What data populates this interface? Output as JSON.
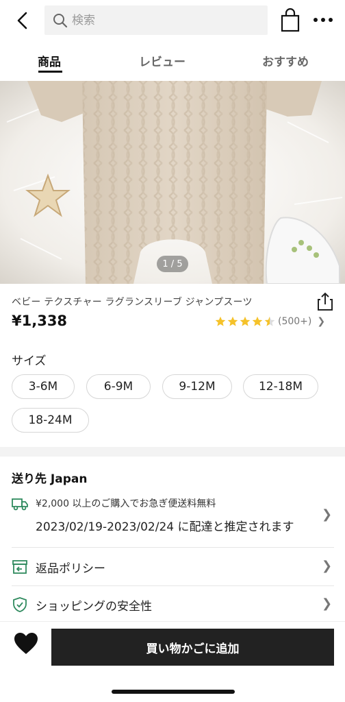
{
  "header": {
    "search_placeholder": "検索"
  },
  "tabs": [
    {
      "label": "商品",
      "active": true
    },
    {
      "label": "レビュー",
      "active": false
    },
    {
      "label": "おすすめ",
      "active": false
    }
  ],
  "gallery": {
    "indicator": "1 / 5"
  },
  "product": {
    "title": "ベビー テクスチャー ラグランスリーブ ジャンプスーツ",
    "price": "¥1,338",
    "rating_value": 4.5,
    "rating_count": "(500+)",
    "star_color": "#f5c22a"
  },
  "size": {
    "label": "サイズ",
    "options": [
      "3-6M",
      "6-9M",
      "9-12M",
      "12-18M",
      "18-24M"
    ]
  },
  "shipping": {
    "title": "送り先 Japan",
    "free_shipping": "¥2,000 以上のご購入でお急ぎ便送料無料",
    "estimate": "2023/02/19-2023/02/24 に配達と推定されます",
    "accent_color": "#2f8a5e"
  },
  "rows": [
    {
      "label": "返品ポリシー",
      "icon": "return-box-icon"
    },
    {
      "label": "ショッピングの安全性",
      "icon": "shield-check-icon"
    }
  ],
  "bottom": {
    "add_to_cart": "買い物かごに追加"
  }
}
